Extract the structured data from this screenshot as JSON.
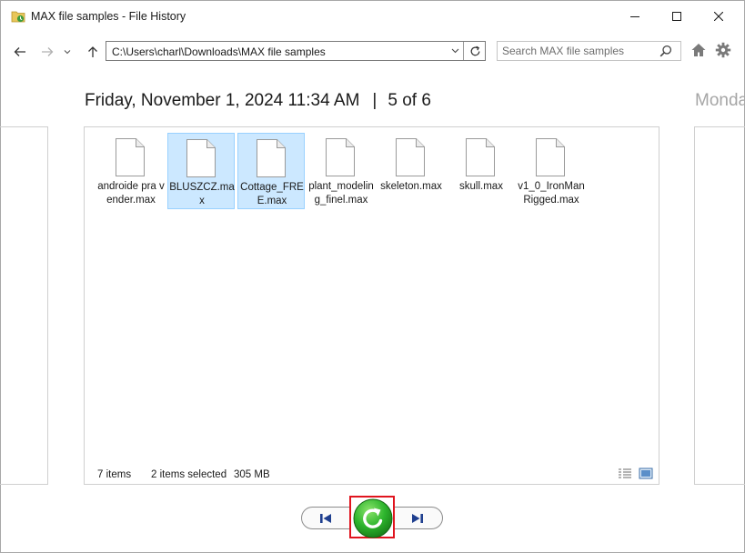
{
  "window": {
    "title": "MAX file samples - File History",
    "minimize_icon": "minimize-icon",
    "maximize_icon": "maximize-icon",
    "close_icon": "close-icon"
  },
  "nav": {
    "address": "C:\\Users\\charl\\Downloads\\MAX file samples",
    "search_placeholder": "Search MAX file samples",
    "icons": [
      "back-arrow-icon",
      "forward-arrow-icon",
      "chevron-down-icon",
      "up-arrow-icon",
      "refresh-icon",
      "search-icon",
      "home-icon",
      "gear-icon"
    ]
  },
  "heading": {
    "date": "Friday, November 1, 2024 11:34 AM",
    "separator": "|",
    "position": "5 of 6",
    "next_date": "Monda"
  },
  "files": [
    {
      "name": "androide pra vender.max",
      "selected": false
    },
    {
      "name": "BLUSZCZ.max",
      "selected": true
    },
    {
      "name": "Cottage_FREE.max",
      "selected": true
    },
    {
      "name": "plant_modeling_finel.max",
      "selected": false
    },
    {
      "name": "skeleton.max",
      "selected": false
    },
    {
      "name": "skull.max",
      "selected": false
    },
    {
      "name": "v1_0_IronManRigged.max",
      "selected": false
    }
  ],
  "status": {
    "items": "7 items",
    "selected": "2 items selected",
    "size": "305 MB"
  },
  "controls": {
    "icons": [
      "previous-version-icon",
      "restore-icon",
      "next-version-icon"
    ]
  },
  "colors": {
    "selection_bg": "#cce8ff",
    "selection_border": "#99d1ff",
    "restore_green": "#2db52d",
    "highlight_red": "#e0141e",
    "nav_blue": "#1f3f8f"
  }
}
